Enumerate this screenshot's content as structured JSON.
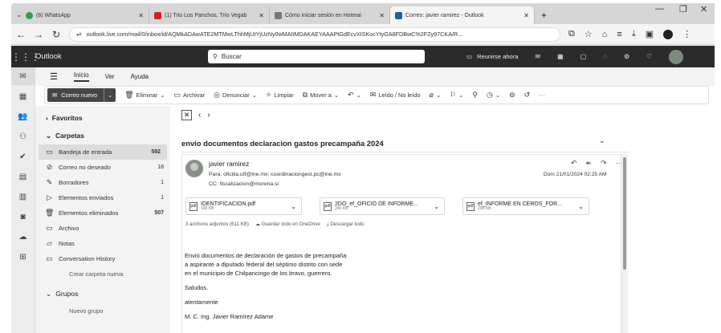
{
  "browser": {
    "tabs": [
      {
        "label": "(6) WhatsApp",
        "icon_color": "#2aa34a"
      },
      {
        "label": "(1) Trio Los Panchos, Trío Vegab",
        "icon_color": "#d32020"
      },
      {
        "label": "Cómo iniciar sesión en Hotmai",
        "icon_color": "#777777"
      },
      {
        "label": "Correo: javier ramirez - Outlook",
        "icon_color": "#1f5fa0"
      }
    ],
    "new_tab": "+",
    "window_controls": [
      "—",
      "❐",
      "✕"
    ],
    "url": "outlook.live.com/mail/0/inbox/id/AQMkADAwATE2MTMwLThhMjUtYjUzNy0wMAItMDAKAEYAAAPtGdEcvXISKocYtyGA8FDBwC%2FZy97CKA/R..."
  },
  "outlook": {
    "brand": "Outlook",
    "search_placeholder": "Buscar",
    "meet_now": "Reunirse ahora",
    "menu": [
      "Inicio",
      "Ver",
      "Ayuda"
    ]
  },
  "ribbon": {
    "new_mail": "Correo nuevo",
    "delete": "Eliminar",
    "archive": "Archivar",
    "report": "Denunciar",
    "sweep": "Limpiar",
    "move": "Mover a",
    "read_unread": "Leído / No leído",
    "more": "···"
  },
  "folders": {
    "favorites": "Favoritos",
    "folders_heading": "Carpetas",
    "items": [
      {
        "label": "Bandeja de entrada",
        "count": "592",
        "icon": "inbox-icon"
      },
      {
        "label": "Correo no deseado",
        "count": "18",
        "icon": "junk-icon"
      },
      {
        "label": "Borradores",
        "count": "1",
        "icon": "pencil-icon"
      },
      {
        "label": "Elementos enviados",
        "count": "1",
        "icon": "send-icon"
      },
      {
        "label": "Elementos eliminados",
        "count": "507",
        "icon": "trash-icon"
      },
      {
        "label": "Archivo",
        "count": "",
        "icon": "archive-icon"
      },
      {
        "label": "Notas",
        "count": "",
        "icon": "note-icon"
      },
      {
        "label": "Conversation History",
        "count": "",
        "icon": "folder-icon"
      }
    ],
    "create_folder": "Crear carpeta nueva",
    "groups_heading": "Grupos",
    "new_group": "Nuevo grupo"
  },
  "message": {
    "subject": "envio documentos declaracion gastos precampaña 2024",
    "sender": "javier ramirez",
    "to": "Para: oficilia.utf@ine.mx; coordinaciongest.pc@ine.mx",
    "cc": "CC: fiscalizacion@morena.si",
    "date": "Dom 21/01/2024 02:25 AM",
    "attachments": [
      {
        "name": "IDENTIFICACION.pdf",
        "size": "168 KB"
      },
      {
        "name": "2DO_ef_OFICIO DE INFORME...",
        "size": "240 KB"
      },
      {
        "name": "ef_INFORME EN CEROS_FOR...",
        "size": "298 KB"
      }
    ],
    "attachment_summary": "3 archivos adjuntos (611 KB)",
    "save_onedrive": "Guardar todo en OneDrive",
    "download_all": "Descargar todo",
    "body": [
      "Envió documentos de declaración de gastos de precampaña",
      "a aspirante a diputado federal del séptimo distrito con sede",
      "en el municipio de Chilpancingo de los bravo, guerrero."
    ],
    "greeting": "Saludos.",
    "closing": "atentamente",
    "signature": "M. C. Ing. Javier Ramírez Adame"
  }
}
